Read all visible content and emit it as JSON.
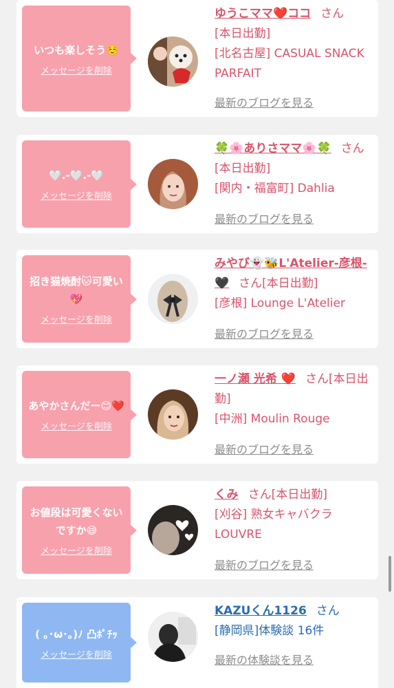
{
  "messages": [
    {
      "bubble_text": "いつも楽しそう☺️",
      "delete_label": "メッセージを削除",
      "name": "ゆうこママ❤️ココ",
      "suffix": "さん",
      "status": "[本日出勤]",
      "location": "[北名古屋] CASUAL SNACK PARFAIT",
      "link": "最新のブログを見る",
      "bubble_color": "#f7a1ad",
      "avatar_icon": "avatar-dog-photo"
    },
    {
      "bubble_text": "🤍.-🤍.-🤍",
      "delete_label": "メッセージを削除",
      "name": "🍀🌸ありさママ🌸🍀",
      "suffix": "さん[本日出勤]",
      "location": "[関内・福富町] Dahlia",
      "link": "最新のブログを見る",
      "bubble_color": "#f7a1ad",
      "avatar_icon": "avatar-woman-photo"
    },
    {
      "bubble_text": "招き猫焼酎🐱可愛い💖",
      "delete_label": "メッセージを削除",
      "name": "みやび👻🐝L'Atelier-彦根-🖤",
      "suffix": "さん[本日出勤]",
      "location": "[彦根] Lounge L'Atelier",
      "link": "最新のブログを見る",
      "bubble_color": "#f7a1ad",
      "avatar_icon": "avatar-hair-ribbon-photo"
    },
    {
      "bubble_text": "あやかさんだー😊❤️",
      "delete_label": "メッセージを削除",
      "name": "一ノ瀬 光希 ❤️",
      "suffix": "さん[本日出勤]",
      "location": "[中洲] Moulin Rouge",
      "link": "最新のブログを見る",
      "bubble_color": "#f7a1ad",
      "avatar_icon": "avatar-woman-photo"
    },
    {
      "bubble_text": "お値段は可愛くないですか😅",
      "delete_label": "メッセージを削除",
      "name": "くみ",
      "suffix": "さん[本日出勤]",
      "location": "[刈谷] 熟女キャバクラ LOUVRE",
      "link": "最新のブログを見る",
      "bubble_color": "#f7a1ad",
      "avatar_icon": "avatar-hearts-photo"
    },
    {
      "bubble_text": "( ｡･ω･｡)ﾉ 凸ﾎﾟﾁｯ",
      "delete_label": "メッセージを削除",
      "name": "KAZUくん1126",
      "suffix": "さん",
      "status": "[静岡県]体験談 16件",
      "link": "最新の体験談を見る",
      "bubble_color": "#8fb8f3",
      "avatar_icon": "avatar-man-photo"
    }
  ]
}
